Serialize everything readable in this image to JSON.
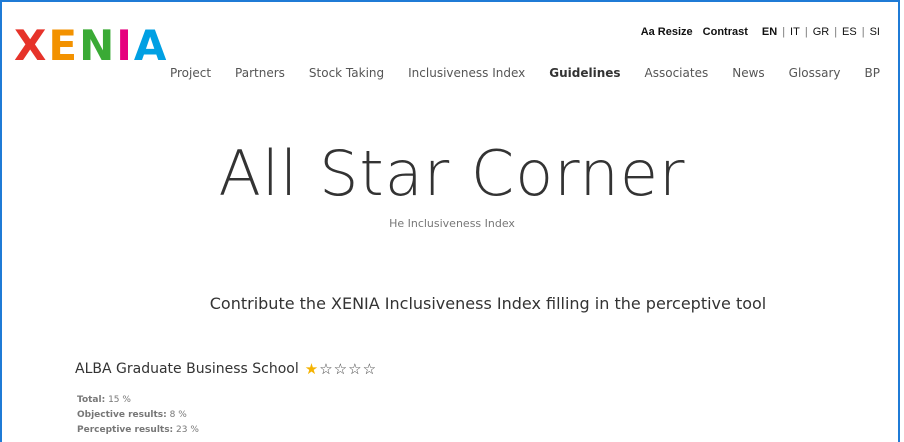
{
  "logo": {
    "letters": [
      "X",
      "E",
      "N",
      "I",
      "A"
    ],
    "colors": [
      "#e6332a",
      "#f39200",
      "#3aaa35",
      "#e6007e",
      "#00a0e3"
    ]
  },
  "utility": {
    "resize": "Aa Resize",
    "contrast": "Contrast",
    "languages": [
      "EN",
      "IT",
      "GR",
      "ES",
      "SI"
    ],
    "active_language": "EN"
  },
  "nav": {
    "items": [
      "Project",
      "Partners",
      "Stock Taking",
      "Inclusiveness Index",
      "Guidelines",
      "Associates",
      "News",
      "Glossary",
      "BP"
    ],
    "active": "Guidelines"
  },
  "hero": {
    "title": "All Star Corner",
    "subtitle": "He Inclusiveness Index"
  },
  "contribute": "Contribute the XENIA Inclusiveness Index filling in the perceptive tool",
  "school": {
    "name": "ALBA Graduate Business School",
    "rating": {
      "filled": 1,
      "max": 5,
      "filled_color": "#f5b301",
      "icon": "star-icon"
    },
    "results": [
      {
        "label": "Total:",
        "value": "15 %"
      },
      {
        "label": "Objective results:",
        "value": "8 %"
      },
      {
        "label": "Perceptive results:",
        "value": "23 %"
      }
    ]
  }
}
